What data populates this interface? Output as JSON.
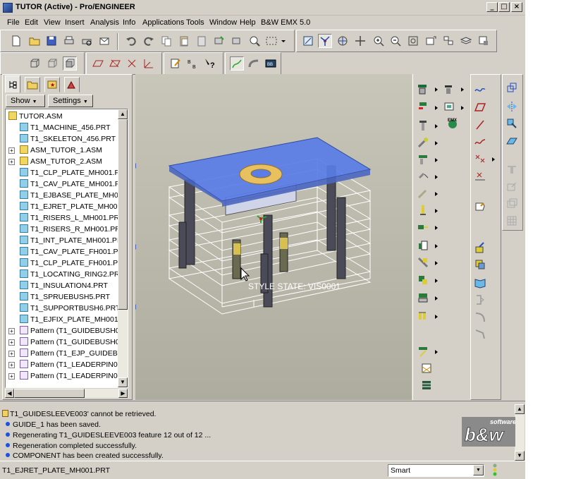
{
  "window": {
    "title": "TUTOR (Active) - Pro/ENGINEER"
  },
  "menu": [
    "File",
    "Edit",
    "View",
    "Insert",
    "Analysis",
    "Info",
    "Applications",
    "Tools",
    "Window",
    "Help",
    "B&W EMX 5.0"
  ],
  "panel": {
    "show_label": "Show",
    "settings_label": "Settings"
  },
  "tree": [
    {
      "label": "TUTOR.ASM",
      "kind": "asm",
      "indent": 0,
      "expand": false
    },
    {
      "label": "T1_MACHINE_456.PRT",
      "kind": "prt",
      "indent": 1,
      "expand": false
    },
    {
      "label": "T1_SKELETON_456.PRT",
      "kind": "prt",
      "indent": 1,
      "expand": false
    },
    {
      "label": "ASM_TUTOR_1.ASM",
      "kind": "asm",
      "indent": 1,
      "expand": true
    },
    {
      "label": "ASM_TUTOR_2.ASM",
      "kind": "asm",
      "indent": 1,
      "expand": true
    },
    {
      "label": "T1_CLP_PLATE_MH001.PF",
      "kind": "prt",
      "indent": 1,
      "expand": false
    },
    {
      "label": "T1_CAV_PLATE_MH001.PF",
      "kind": "prt",
      "indent": 1,
      "expand": false
    },
    {
      "label": "T1_EJBASE_PLATE_MH00",
      "kind": "prt",
      "indent": 1,
      "expand": false
    },
    {
      "label": "T1_EJRET_PLATE_MH001.",
      "kind": "prt",
      "indent": 1,
      "expand": false
    },
    {
      "label": "T1_RISERS_L_MH001.PRT",
      "kind": "prt",
      "indent": 1,
      "expand": false
    },
    {
      "label": "T1_RISERS_R_MH001.PRT",
      "kind": "prt",
      "indent": 1,
      "expand": false
    },
    {
      "label": "T1_INT_PLATE_MH001.PR",
      "kind": "prt",
      "indent": 1,
      "expand": false
    },
    {
      "label": "T1_CAV_PLATE_FH001.PR",
      "kind": "prt",
      "indent": 1,
      "expand": false
    },
    {
      "label": "T1_CLP_PLATE_FH001.PR",
      "kind": "prt",
      "indent": 1,
      "expand": false
    },
    {
      "label": "T1_LOCATING_RING2.PR",
      "kind": "prt",
      "indent": 1,
      "expand": false
    },
    {
      "label": "T1_INSULATION4.PRT",
      "kind": "prt",
      "indent": 1,
      "expand": false
    },
    {
      "label": "T1_SPRUEBUSH5.PRT",
      "kind": "prt",
      "indent": 1,
      "expand": false
    },
    {
      "label": "T1_SUPPORTBUSH6.PRT",
      "kind": "prt",
      "indent": 1,
      "expand": false
    },
    {
      "label": "T1_EJFIX_PLATE_MH001.F",
      "kind": "prt",
      "indent": 1,
      "expand": false
    },
    {
      "label": "Pattern (T1_GUIDEBUSH00",
      "kind": "pat",
      "indent": 1,
      "expand": true
    },
    {
      "label": "Pattern (T1_GUIDEBUSH00",
      "kind": "pat",
      "indent": 1,
      "expand": true
    },
    {
      "label": "Pattern (T1_EJP_GUIDEBUS",
      "kind": "pat",
      "indent": 1,
      "expand": true
    },
    {
      "label": "Pattern (T1_LEADERPIN002",
      "kind": "pat",
      "indent": 1,
      "expand": true
    },
    {
      "label": "Pattern (T1_LEADERPIN002",
      "kind": "pat",
      "indent": 1,
      "expand": true
    }
  ],
  "viewport": {
    "style_state": "STYLE STATE: VIS0001"
  },
  "messages": [
    {
      "text": "T1_GUIDESLEEVE003' cannot be retrieved.",
      "kind": "warn"
    },
    {
      "text": "GUIDE_1 has been saved.",
      "kind": "info"
    },
    {
      "text": "Regenerating T1_GUIDESLEEVE003 feature 12 out of 12 ...",
      "kind": "info"
    },
    {
      "text": "Regeneration completed successfully.",
      "kind": "info"
    },
    {
      "text": "COMPONENT has been created successfully.",
      "kind": "info"
    }
  ],
  "status": {
    "text": "T1_EJRET_PLATE_MH001.PRT",
    "filter": "Smart"
  },
  "logo": {
    "text": "b&w",
    "subtext": "software"
  },
  "colors": {
    "top_plate": "#5a7de8",
    "ring": "#e8c060",
    "viewport_bg": "#b8b6a8"
  }
}
